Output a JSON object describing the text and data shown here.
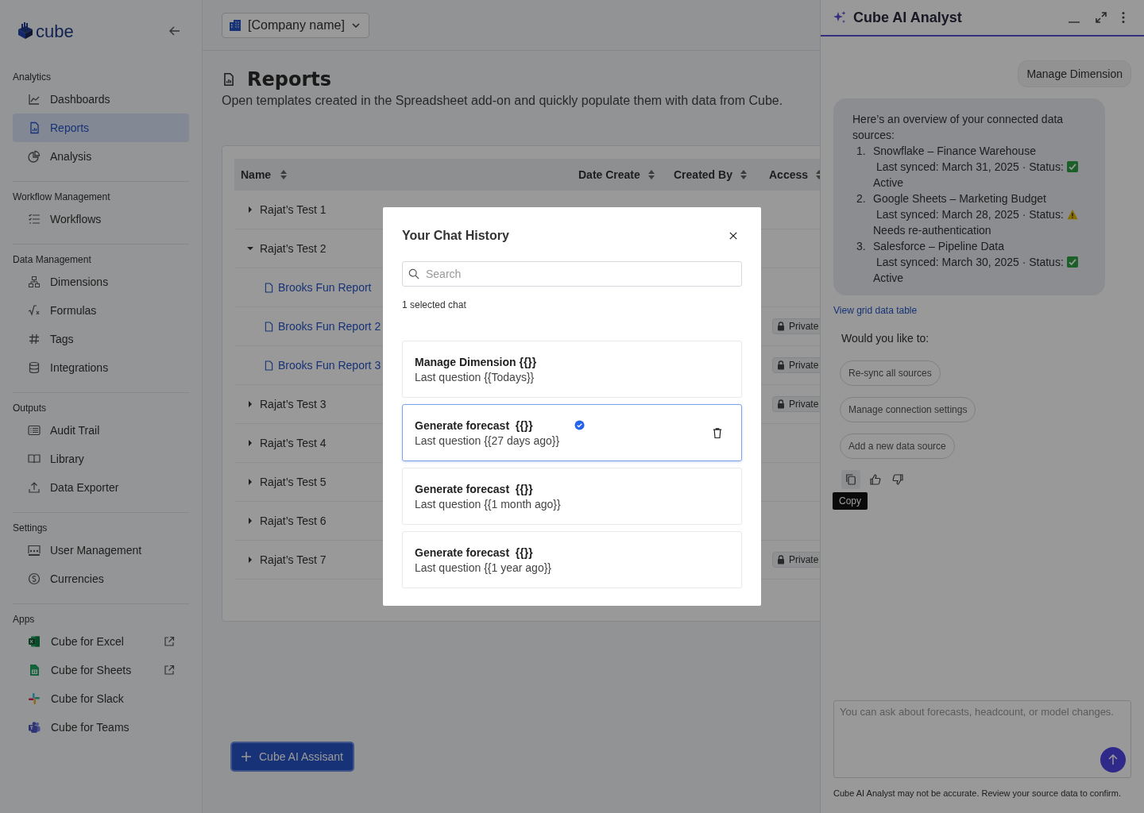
{
  "sidebar": {
    "logo": "cube",
    "sections": [
      {
        "title": "Analytics",
        "items": [
          {
            "label": "Dashboards",
            "selected": false
          },
          {
            "label": "Reports",
            "selected": true
          },
          {
            "label": "Analysis",
            "selected": false
          }
        ]
      },
      {
        "title": "Workflow Management",
        "items": [
          {
            "label": "Workflows",
            "selected": false
          }
        ]
      },
      {
        "title": "Data Management",
        "items": [
          {
            "label": "Dimensions",
            "selected": false
          },
          {
            "label": "Formulas",
            "selected": false
          },
          {
            "label": "Tags",
            "selected": false
          },
          {
            "label": "Integrations",
            "selected": false
          }
        ]
      },
      {
        "title": "Outputs",
        "items": [
          {
            "label": "Audit Trail",
            "selected": false
          },
          {
            "label": "Library",
            "selected": false
          },
          {
            "label": "Data Exporter",
            "selected": false
          }
        ]
      },
      {
        "title": "Settings",
        "items": [
          {
            "label": "User Management",
            "selected": false
          },
          {
            "label": "Currencies",
            "selected": false
          }
        ]
      }
    ],
    "apps": {
      "title": "Apps",
      "items": [
        {
          "label": "Cube for Excel",
          "external": true
        },
        {
          "label": "Cube for Sheets",
          "external": true
        },
        {
          "label": "Cube for Slack",
          "external": false
        },
        {
          "label": "Cube for Teams",
          "external": false
        }
      ]
    }
  },
  "header": {
    "company": "[Company name]"
  },
  "page": {
    "title": "Reports",
    "description": "Open templates created in the Spreadsheet add-on and quickly populate them with data from Cube."
  },
  "table": {
    "columns": [
      "Name",
      "Date Create",
      "Created By",
      "Access"
    ],
    "rows": [
      {
        "name": "Rajat’s Test 1",
        "expanded": false
      },
      {
        "name": "Rajat’s Test 2",
        "expanded": true,
        "children": [
          {
            "name": "Brooks Fun Report"
          },
          {
            "name": "Brooks Fun Report 2",
            "access": "Private"
          },
          {
            "name": "Brooks Fun Report 3",
            "access": "Private"
          }
        ]
      },
      {
        "name": "Rajat’s Test 3",
        "expanded": false,
        "access": "Private"
      },
      {
        "name": "Rajat’s Test 4",
        "expanded": false
      },
      {
        "name": "Rajat’s Test 5",
        "expanded": false
      },
      {
        "name": "Rajat’s Test 6",
        "expanded": false
      },
      {
        "name": "Rajat’s Test 7",
        "expanded": false,
        "access": "Private"
      }
    ]
  },
  "assistant_button": "Cube AI Assisant",
  "modal": {
    "title": "Your Chat History",
    "search": {
      "placeholder": "Search"
    },
    "selection_count": "1 selected chat",
    "chats": [
      {
        "title": "Manage Dimension {{}}",
        "subtitle": "Last question {{Todays}}",
        "selected": false
      },
      {
        "title": "Generate forecast  {{}}",
        "subtitle": "Last question {{27 days ago}}",
        "selected": true
      },
      {
        "title": "Generate forecast  {{}}",
        "subtitle": "Last question {{1 month ago}}",
        "selected": false
      },
      {
        "title": "Generate forecast  {{}}",
        "subtitle": "Last question {{1 year ago}}",
        "selected": false
      }
    ]
  },
  "chat_panel": {
    "title": "Cube AI Analyst",
    "user_message": "Manage Dimension",
    "answer": {
      "intro": "Here’s an overview of your connected data sources:",
      "sources": [
        {
          "number": "1.",
          "name": "Snowflake – Finance Warehouse",
          "synced": "Last synced: March 31, 2025 · Status:",
          "kind": "ok",
          "status": "Active"
        },
        {
          "number": "2.",
          "name": "Google Sheets – Marketing Budget",
          "synced": "Last synced: March 28, 2025 · Status:",
          "kind": "warning",
          "status": "Needs re-authentication"
        },
        {
          "number": "3.",
          "name": "Salesforce – Pipeline Data",
          "synced": "Last synced: March 30, 2025 · Status:",
          "kind": "ok",
          "status": "Active"
        }
      ]
    },
    "link": "View grid data table",
    "prompt": "Would you like to:",
    "suggestions": [
      "Re-sync all sources",
      "Manage connection settings",
      "Add a new data source"
    ],
    "tooltip": "Copy",
    "input": {
      "placeholder": "You can ask about forecasts, headcount, or model changes."
    },
    "disclaimer": "Cube AI Analyst may not be accurate. Review your source data to confirm."
  }
}
